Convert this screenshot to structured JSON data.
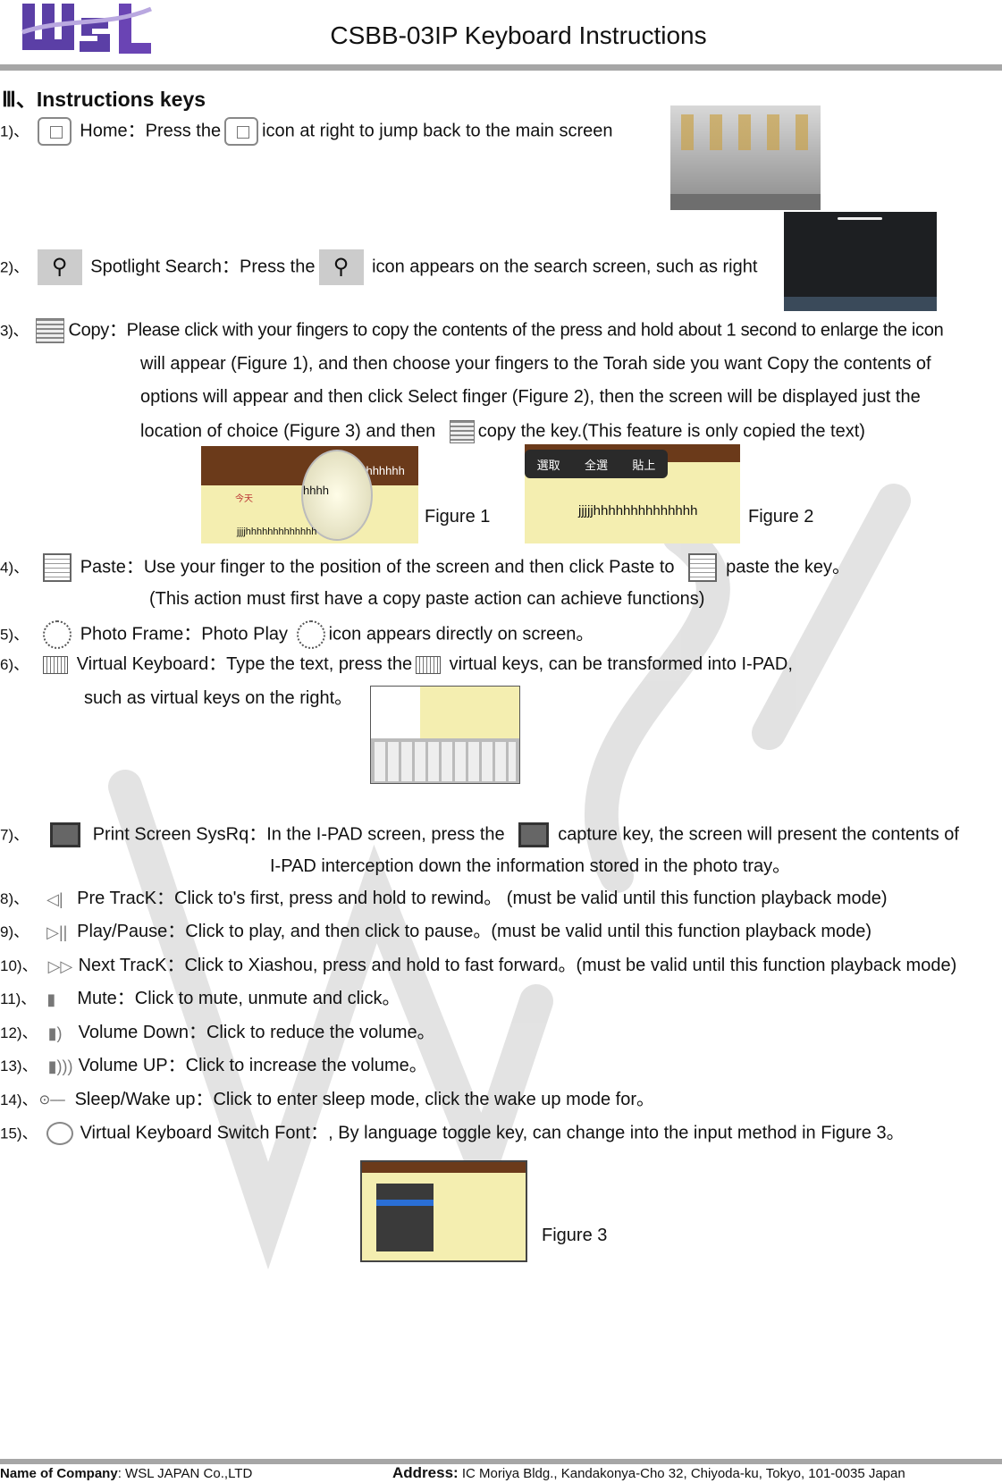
{
  "header": {
    "logo_text": "WSL",
    "title": "CSBB-03IP Keyboard Instructions"
  },
  "section": {
    "heading": "Ⅲ、Instructions keys"
  },
  "items": [
    {
      "num": "1)、",
      "parts": [
        "Home：Press the",
        "icon at right to jump back to the main screen"
      ],
      "icon": "home-button-icon"
    },
    {
      "num": "2)、",
      "parts": [
        "Spotlight Search：Press the",
        "icon appears on the search screen, such as right"
      ],
      "icon": "search-icon"
    },
    {
      "num": "3)、",
      "parts": [
        "Copy：Please click with your fingers to copy the contents of the press and hold about 1 second to enlarge the icon",
        "will appear (Figure 1), and then choose your fingers to the Torah side you want Copy the contents of",
        "options will appear and then click Select finger (Figure 2), then the screen will be displayed just the",
        "location of choice (Figure 3) and then",
        "copy the key.(This feature is only copied the text)"
      ],
      "icon": "copy-icon"
    },
    {
      "num": "4)、",
      "parts": [
        "Paste：Use your finger to the position of the screen and then click Paste to",
        "paste the key。",
        "(This action must first have a copy paste action can achieve functions)"
      ],
      "icon": "paste-icon"
    },
    {
      "num": "5)、",
      "parts": [
        "Photo Frame：Photo Play",
        "icon appears directly on screen。"
      ],
      "icon": "photo-frame-icon"
    },
    {
      "num": "6)、",
      "parts": [
        "Virtual Keyboard：Type the text, press the",
        "virtual keys, can be transformed into I-PAD,",
        "such as virtual keys on the right。"
      ],
      "icon": "keyboard-icon"
    },
    {
      "num": "7)、",
      "parts": [
        "Print Screen SysRq：In the I-PAD screen, press the",
        "capture key, the screen will present the contents of",
        "I-PAD interception down the information stored in the photo tray。"
      ],
      "icon": "monitor-icon"
    },
    {
      "num": "8)、",
      "parts": [
        "Pre TracK：Click to's first, press and hold to rewind。 (must be valid until this function playback mode)"
      ],
      "icon": "previous-track-icon"
    },
    {
      "num": "9)、",
      "parts": [
        "Play/Pause：Click to play, and then click to pause。(must be valid until this function playback mode)"
      ],
      "icon": "play-pause-icon"
    },
    {
      "num": "10)、",
      "parts": [
        "Next TracK：Click to Xiashou, press and hold to fast forward。(must be valid until this function playback mode)"
      ],
      "icon": "next-track-icon"
    },
    {
      "num": "11)、",
      "parts": [
        "Mute：Click to mute, unmute and click。"
      ],
      "icon": "mute-icon"
    },
    {
      "num": "12)、",
      "parts": [
        "Volume Down：Click to reduce the volume。"
      ],
      "icon": "volume-down-icon"
    },
    {
      "num": "13)、",
      "parts": [
        "Volume UP：Click to increase the volume。"
      ],
      "icon": "volume-up-icon"
    },
    {
      "num": "14)、",
      "parts": [
        "Sleep/Wake up：Click to enter sleep mode, click the wake up mode for。"
      ],
      "icon": "sleep-key-icon"
    },
    {
      "num": "15)、",
      "parts": [
        "Virtual Keyboard Switch Font：, By language toggle key, can change into the input method in Figure 3。"
      ],
      "icon": "globe-icon"
    }
  ],
  "figures": {
    "fig1": {
      "label": "Figure 1",
      "screen_text": [
        "hhhhhhhh",
        "hhhh",
        "今天",
        "jjjjhhhhhhhhhhhhh"
      ]
    },
    "fig2": {
      "label": "Figure 2",
      "menu": [
        "選取",
        "全選",
        "貼上"
      ],
      "screen_text": "jjjjjhhhhhhhhhhhhhh"
    },
    "fig3": {
      "label": "Figure 3"
    }
  },
  "footer": {
    "company_label": "Name of Company",
    "company": ": WSL JAPAN Co.,LTD",
    "address_label": "Address:",
    "address": " IC Moriya Bldg., Kandakonya-Cho 32, Chiyoda-ku, Tokyo, 101-0035 Japan"
  },
  "colors": {
    "logo": "#5b3fa6",
    "rule": "#a6a6a6",
    "note_paper": "#f4eeb0",
    "leather": "#6b3a1a"
  }
}
